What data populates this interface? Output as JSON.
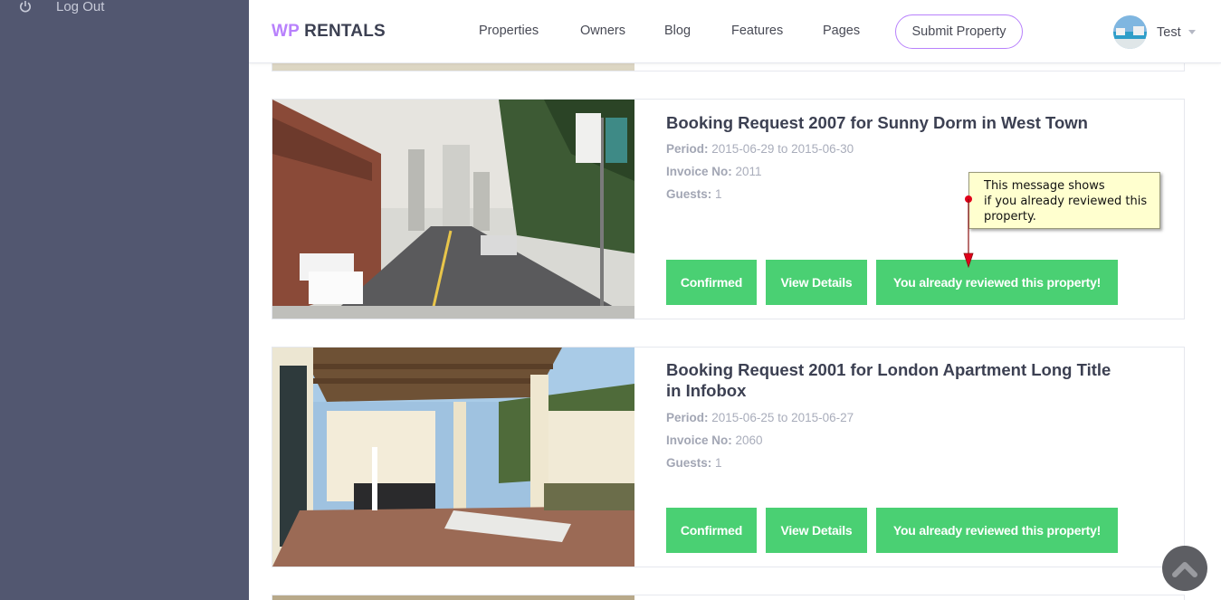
{
  "sidebar": {
    "logout_label": "Log Out",
    "logout_icon": "power-icon"
  },
  "header": {
    "logo_wp": "WP",
    "logo_rentals": "RENTALS",
    "nav": [
      "Properties",
      "Owners",
      "Blog",
      "Features",
      "Pages"
    ],
    "submit_label": "Submit Property",
    "user_name": "Test",
    "accent": "#b881fc"
  },
  "bookings": [
    {
      "title": "Booking Request 2007 for Sunny Dorm in West Town",
      "period_label": "Period:",
      "period_value": "2015-06-29 to 2015-06-30",
      "invoice_label": "Invoice No:",
      "invoice_value": "2011",
      "guests_label": "Guests:",
      "guests_value": "1",
      "status_label": "Confirmed",
      "details_label": "View Details",
      "review_label": "You already reviewed this property!"
    },
    {
      "title": "Booking Request 2001 for London Apartment Long Title in Infobox",
      "period_label": "Period:",
      "period_value": "2015-06-25 to 2015-06-27",
      "invoice_label": "Invoice No:",
      "invoice_value": "2060",
      "guests_label": "Guests:",
      "guests_value": "1",
      "status_label": "Confirmed",
      "details_label": "View Details",
      "review_label": "You already reviewed this property!"
    }
  ],
  "callout": {
    "line1": "This message shows",
    "line2": "if you already reviewed this",
    "line3": "property."
  },
  "colors": {
    "sidebar": "#525770",
    "button_green": "#4ad073",
    "title": "#3c4052"
  }
}
